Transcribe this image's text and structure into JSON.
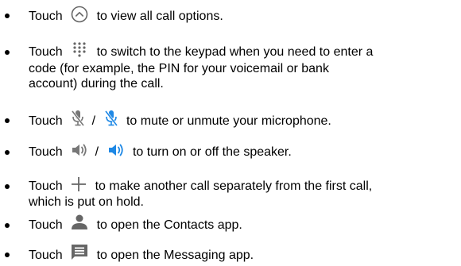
{
  "colors": {
    "text": "#000000",
    "icon_gray": "#666666",
    "icon_blue": "#1E88E5"
  },
  "items": [
    {
      "icon": "chevron-up-circle-icon",
      "lines": [
        {
          "before": "Touch",
          "after": "to view all call options."
        }
      ]
    },
    {
      "icon": "keypad-icon",
      "lines": [
        {
          "before": "Touch",
          "after": "to switch to the keypad when you need to enter a"
        },
        {
          "text": "code (for example, the PIN for your voicemail or bank"
        },
        {
          "text": "account) during the call."
        }
      ]
    },
    {
      "icons": [
        "mic-off-gray-icon",
        "mic-off-blue-icon"
      ],
      "lines": [
        {
          "before": "Touch",
          "sep": "/",
          "after": "to mute or unmute your microphone."
        }
      ]
    },
    {
      "icons": [
        "speaker-gray-icon",
        "speaker-blue-icon"
      ],
      "lines": [
        {
          "before": "Touch",
          "sep": "/",
          "after": "to turn on or off the speaker."
        }
      ]
    },
    {
      "icon": "add-call-icon",
      "lines": [
        {
          "before": "Touch",
          "after": "to make another call separately from the first call,"
        },
        {
          "text": "which is put on hold."
        }
      ]
    },
    {
      "icon": "contacts-icon",
      "lines": [
        {
          "before": "Touch",
          "after": "to open the Contacts app."
        }
      ]
    },
    {
      "icon": "messaging-icon",
      "lines": [
        {
          "before": "Touch",
          "after": "to open the Messaging app."
        }
      ]
    }
  ]
}
